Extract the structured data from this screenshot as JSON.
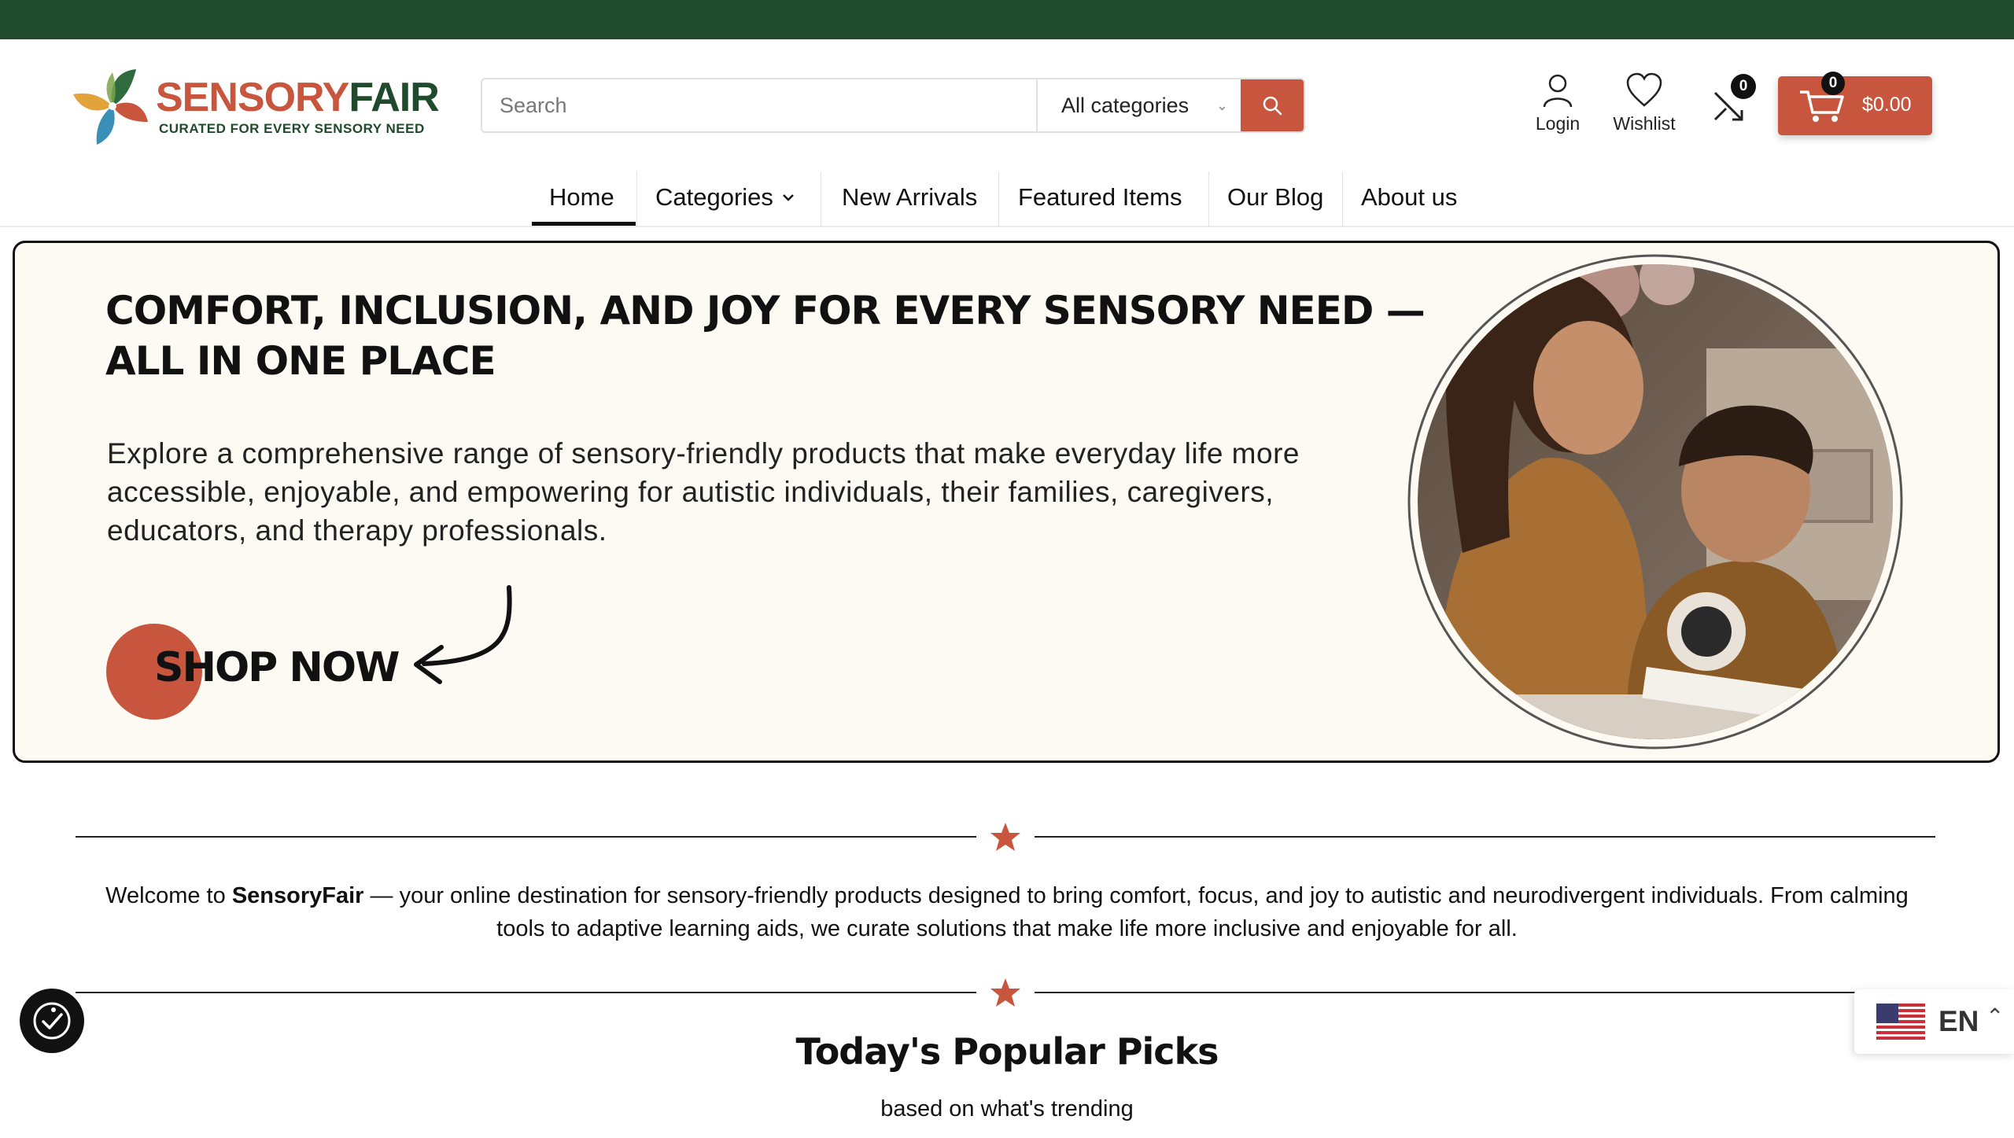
{
  "brand": {
    "name_part1": "SENSORY",
    "name_part2": "FAIR",
    "tagline": "CURATED FOR EVERY SENSORY NEED"
  },
  "search": {
    "placeholder": "Search",
    "category_selected": "All categories"
  },
  "header": {
    "login_label": "Login",
    "wishlist_label": "Wishlist",
    "compare_count": "0",
    "cart_count": "0",
    "cart_total": "$0.00"
  },
  "nav": {
    "items": [
      {
        "label": "Home",
        "active": true
      },
      {
        "label": "Categories",
        "has_dropdown": true
      },
      {
        "label": "New Arrivals"
      },
      {
        "label": "Featured Items"
      },
      {
        "label": "Our Blog"
      },
      {
        "label": "About us"
      }
    ]
  },
  "hero": {
    "headline": "COMFORT, INCLUSION, AND JOY FOR EVERY SENSORY NEED — ALL IN ONE PLACE",
    "body": "Explore a comprehensive range of sensory-friendly products that make everyday life more accessible, enjoyable, and empowering for autistic individuals, their families, caregivers, educators, and therapy professionals.",
    "cta": "SHOP NOW"
  },
  "welcome": {
    "prefix": "Welcome to ",
    "brand": "SensoryFair",
    "text": " — your online destination for sensory-friendly products designed to bring comfort, focus, and joy to autistic and neurodivergent individuals. From calming tools to adaptive learning aids, we curate solutions that make life more inclusive and enjoyable for all."
  },
  "popular": {
    "title": "Today's Popular Picks",
    "subtitle": "based on what's trending"
  },
  "language": {
    "code": "EN"
  },
  "colors": {
    "topbar": "#1f4a2c",
    "accent": "#c8553d",
    "hero_bg": "#fdf9f3"
  }
}
